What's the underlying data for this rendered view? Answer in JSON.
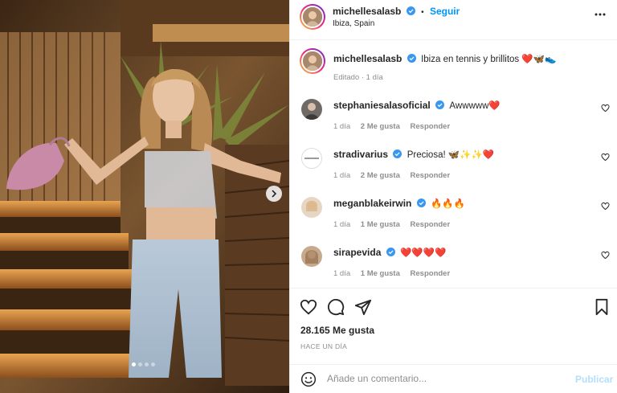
{
  "post": {
    "author": "michellesalasb",
    "follow_label": "Seguir",
    "separator": "•",
    "location": "Ibiza, Spain",
    "caption": "Ibiza en tennis y brillitos ❤️🦋👟",
    "caption_meta": "Editado · 1 día",
    "more_icon": "more-horizontal-icon",
    "carousel_dots": 4,
    "carousel_active": 0
  },
  "comments": [
    {
      "user": "stephaniesalasoficial",
      "text": "Awwwww❤️",
      "time": "1 día",
      "likes": "2 Me gusta",
      "reply": "Responder"
    },
    {
      "user": "stradivarius",
      "text": "Preciosa! 🦋✨✨❤️",
      "time": "1 día",
      "likes": "2 Me gusta",
      "reply": "Responder"
    },
    {
      "user": "meganblakeirwin",
      "text": "🔥🔥🔥",
      "time": "1 día",
      "likes": "1 Me gusta",
      "reply": "Responder"
    },
    {
      "user": "sirapevida",
      "text": "❤️❤️❤️❤️",
      "time": "1 día",
      "likes": "1 Me gusta",
      "reply": "Responder"
    }
  ],
  "engagement": {
    "likes": "28.165 Me gusta",
    "posted": "HACE UN DÍA"
  },
  "composer": {
    "placeholder": "Añade un comentario...",
    "publish_label": "Publicar"
  },
  "colors": {
    "accent": "#0095f6",
    "publish_disabled": "#b2dffc",
    "verified": "#3897f0",
    "muted": "#8e8e8e"
  }
}
